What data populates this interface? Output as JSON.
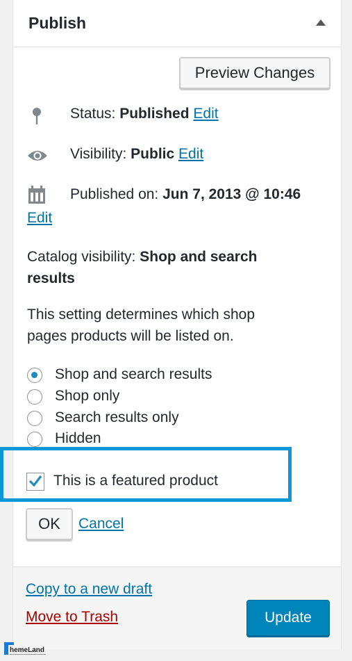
{
  "panel": {
    "title": "Publish",
    "preview_button": "Preview Changes"
  },
  "status": {
    "label": "Status:",
    "value": "Published",
    "edit": "Edit"
  },
  "visibility": {
    "label": "Visibility:",
    "value": "Public",
    "edit": "Edit"
  },
  "published_on": {
    "label": "Published on:",
    "value": "Jun 7, 2013 @ 10:46",
    "edit": "Edit"
  },
  "catalog": {
    "label": "Catalog visibility:",
    "value_line1": "Shop and search",
    "value_line2": "results",
    "description_line1": "This setting determines which shop",
    "description_line2": "pages products will be listed on.",
    "options": [
      "Shop and search results",
      "Shop only",
      "Search results only",
      "Hidden"
    ],
    "selected": "Shop and search results",
    "featured_label": "This is a featured product",
    "featured_checked": true,
    "ok": "OK",
    "cancel": "Cancel"
  },
  "footer": {
    "copy_draft": "Copy to a new draft",
    "trash": "Move to Trash",
    "update": "Update"
  },
  "watermark": {
    "text": "ThemeLand"
  },
  "colors": {
    "accent": "#0085ba",
    "link": "#0073aa",
    "danger": "#a00",
    "highlight": "#0a98d8"
  }
}
